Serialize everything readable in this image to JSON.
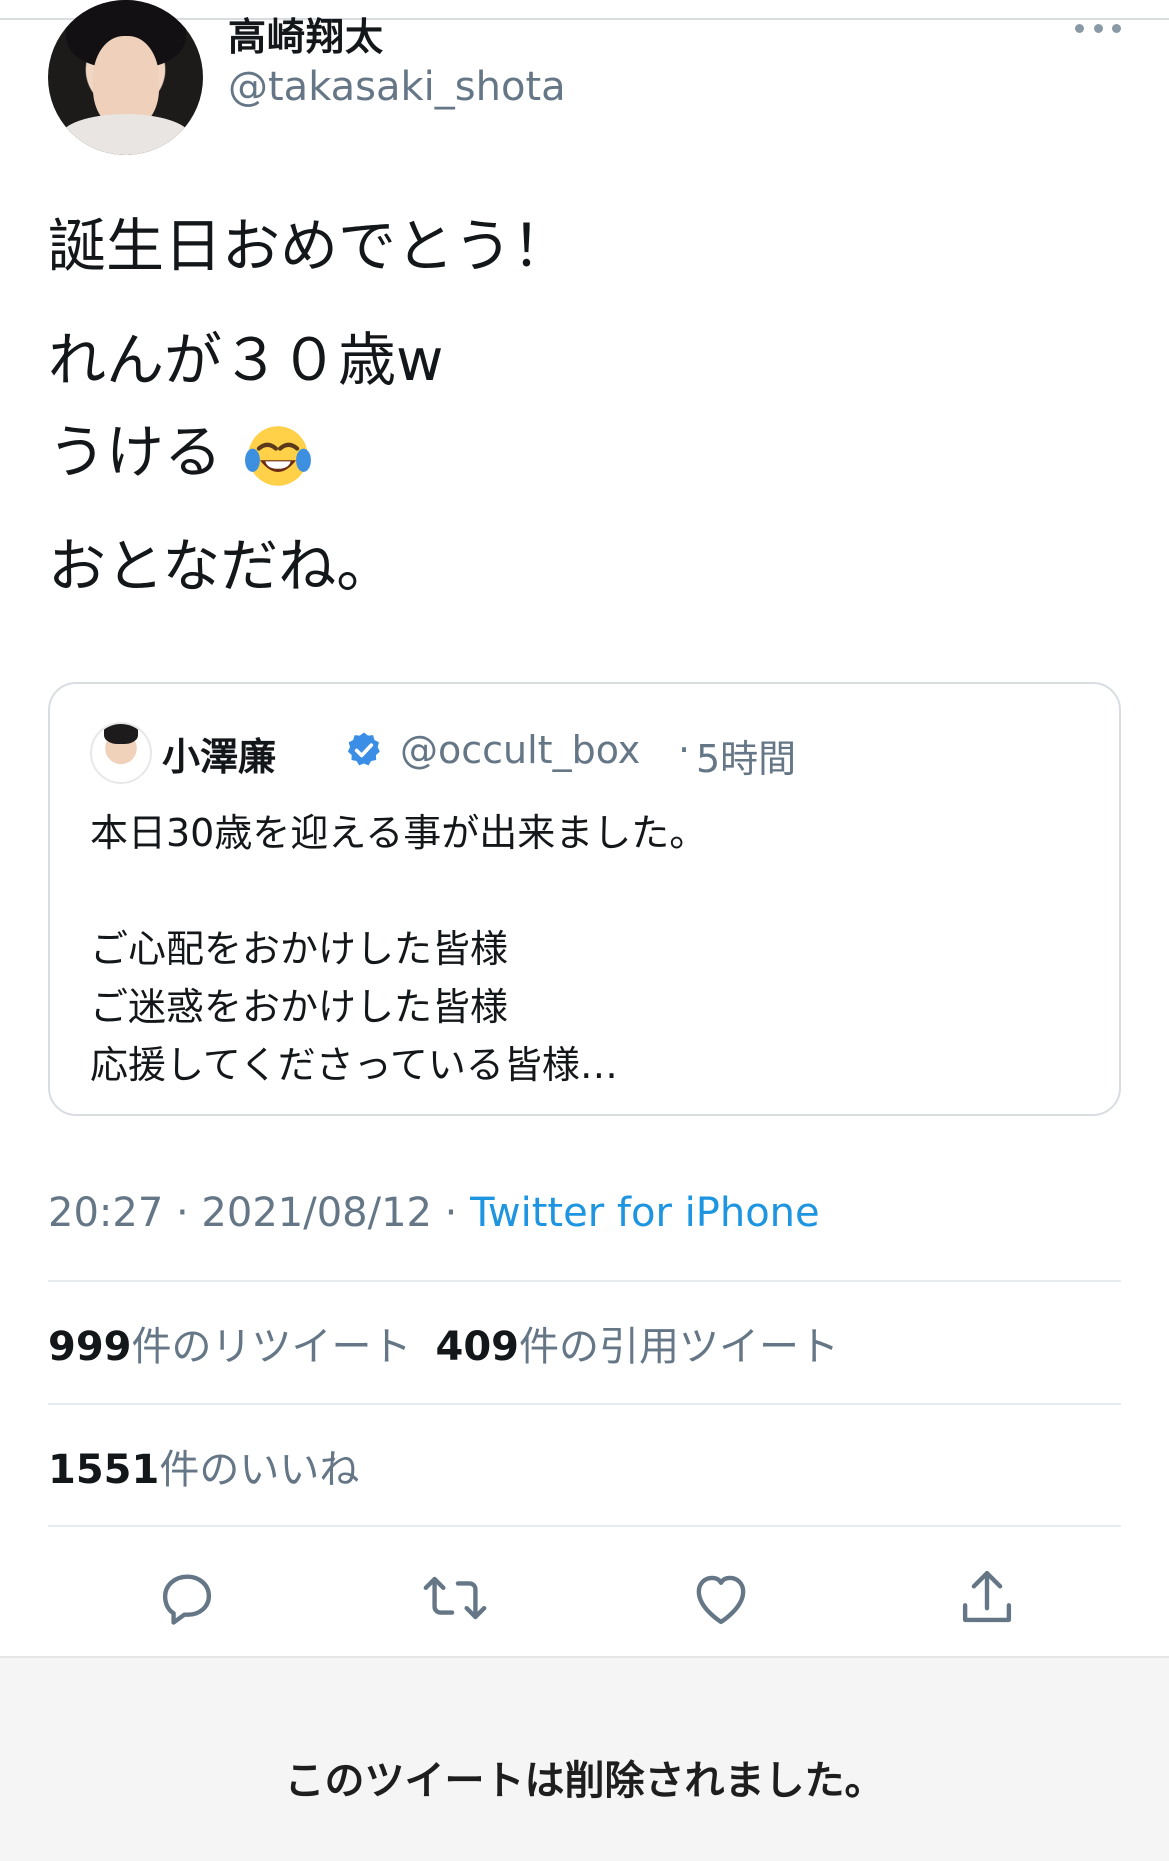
{
  "tweet": {
    "author": {
      "display_name": "高崎翔太",
      "handle": "@takasaki_shota"
    },
    "text_lines": [
      "誕生日おめでとう！",
      "れんが３０歳w",
      "うける",
      "おとなだね。"
    ],
    "emoji": "face-with-tears-of-joy",
    "timestamp": "20:27 · 2021/08/12 · ",
    "source": "Twitter for iPhone",
    "retweets": {
      "count": "999",
      "label": "件のリツイート"
    },
    "quote_tweets": {
      "count": "409",
      "label": "件の引用ツイート"
    },
    "likes": {
      "count": "1551",
      "label": "件のいいね"
    }
  },
  "quoted_tweet": {
    "author": {
      "display_name": "小澤廉",
      "verified": true,
      "handle": "@occult_box"
    },
    "separator": "·",
    "time_ago": "5時間",
    "text_lines": [
      "本日30歳を迎える事が出来ました。",
      "",
      "ご心配をおかけした皆様",
      "ご迷惑をおかけした皆様",
      "応援してくださっている皆様…"
    ]
  },
  "actions": {
    "icons": [
      "reply-icon",
      "retweet-icon",
      "like-icon",
      "share-icon"
    ]
  },
  "notice": {
    "deleted_message": "このツイートは削除されました。"
  },
  "colors": {
    "text": "#14171a",
    "secondary": "#657786",
    "link": "#1d95e0",
    "verified": "#1da1f2",
    "border": "#d9dde1",
    "action": "#657786",
    "banner_bg": "#f5f5f5"
  }
}
